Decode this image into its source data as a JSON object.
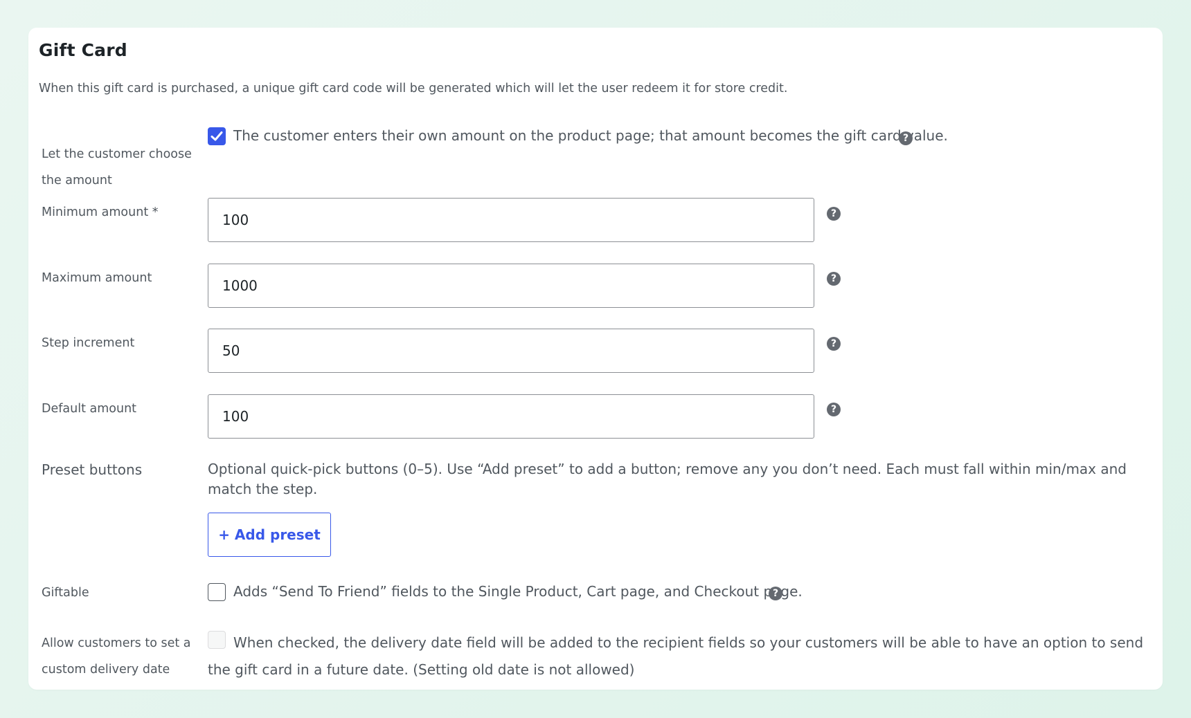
{
  "panel": {
    "title": "Gift Card",
    "description": "When this gift card is purchased, a unique gift card code will be generated which will let the user redeem it for store credit."
  },
  "choose_amount": {
    "label_line1": "Let the customer choose",
    "label_line2": "the amount",
    "checked": true,
    "text": "The customer enters their own amount on the product page; that amount becomes the gift card value."
  },
  "minimum_amount": {
    "label": "Minimum amount *",
    "value": "100"
  },
  "maximum_amount": {
    "label": "Maximum amount",
    "value": "1000"
  },
  "step_increment": {
    "label": "Step increment",
    "value": "50"
  },
  "default_amount": {
    "label": "Default amount",
    "value": "100"
  },
  "preset_buttons": {
    "label": "Preset buttons",
    "description": "Optional quick-pick buttons (0–5). Use “Add preset” to add a button; remove any you don’t need. Each must fall within min/max and match the step.",
    "add_label": "+ Add preset"
  },
  "giftable": {
    "label": "Giftable",
    "checked": false,
    "text": "Adds “Send To Friend” fields to the Single Product, Cart page, and Checkout page."
  },
  "delivery_date": {
    "label_line1": "Allow customers to set a",
    "label_line2": "custom delivery date",
    "checked": false,
    "disabled": true,
    "text": "When checked, the delivery date field will be added to the recipient fields so your customers will be able to have an option to send the gift card in a future date. (Setting old date is not allowed)"
  },
  "icons": {
    "help": "help-icon",
    "check": "checkmark-icon"
  },
  "colors": {
    "accent": "#3858e9",
    "help_icon": "#646970",
    "text": "#50575e",
    "heading": "#1d2327"
  }
}
